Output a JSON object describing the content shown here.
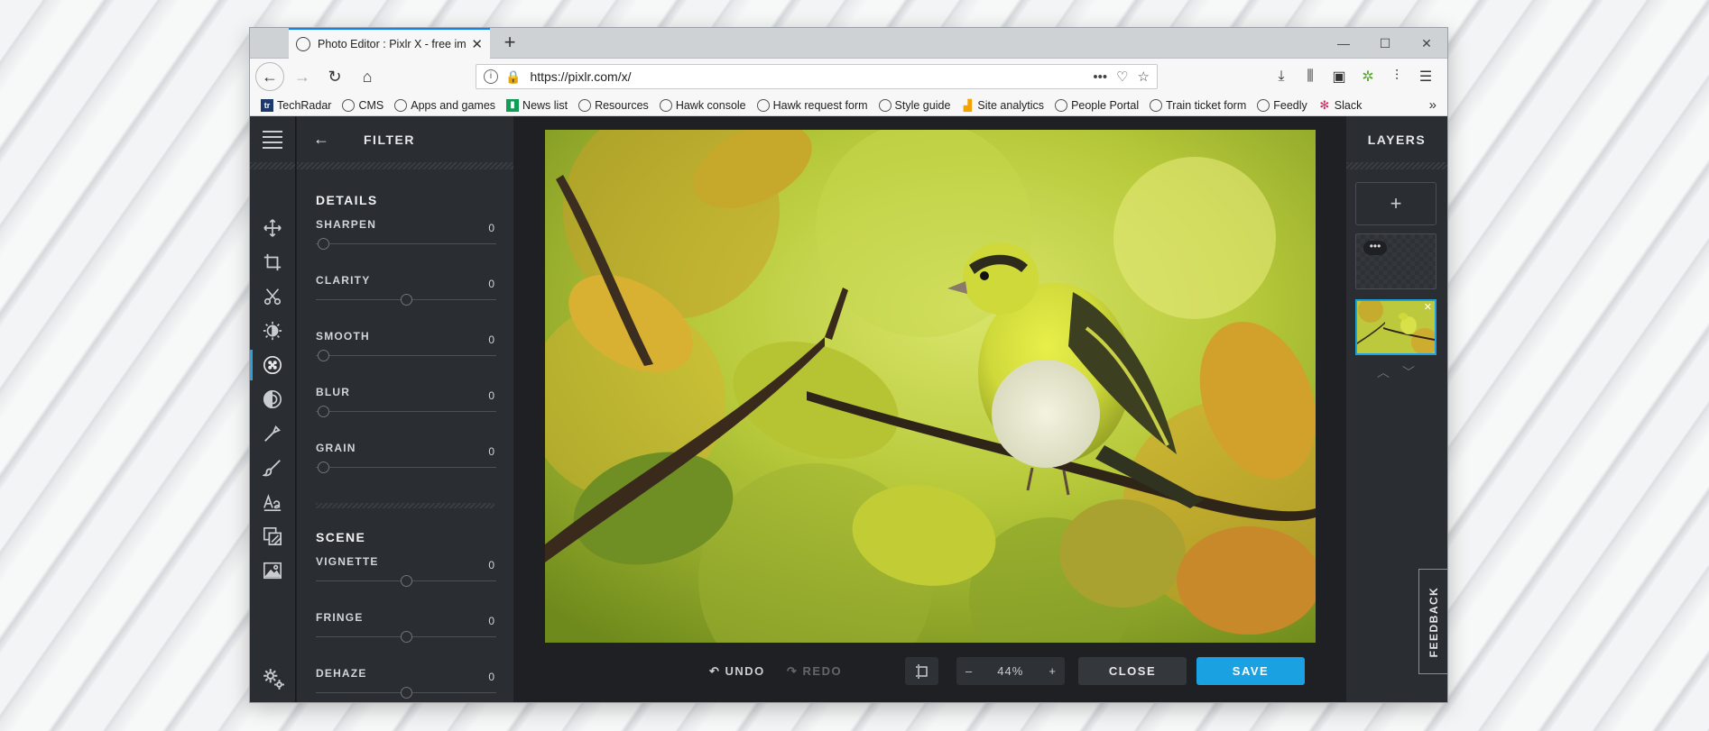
{
  "browser": {
    "tab_title": "Photo Editor : Pixlr X - free image editing online",
    "url": "https://pixlr.com/x/",
    "bookmarks": [
      {
        "label": "TechRadar",
        "icon": "techradar-icon"
      },
      {
        "label": "CMS",
        "icon": "globe-icon"
      },
      {
        "label": "Apps and games",
        "icon": "globe-icon"
      },
      {
        "label": "News list",
        "icon": "news-icon"
      },
      {
        "label": "Resources",
        "icon": "globe-icon"
      },
      {
        "label": "Hawk console",
        "icon": "globe-icon"
      },
      {
        "label": "Hawk request form",
        "icon": "globe-icon"
      },
      {
        "label": "Style guide",
        "icon": "globe-icon"
      },
      {
        "label": "Site analytics",
        "icon": "analytics-icon"
      },
      {
        "label": "People Portal",
        "icon": "globe-icon"
      },
      {
        "label": "Train ticket form",
        "icon": "globe-icon"
      },
      {
        "label": "Feedly",
        "icon": "globe-icon"
      },
      {
        "label": "Slack",
        "icon": "slack-icon"
      }
    ]
  },
  "panel": {
    "title": "FILTER",
    "sections": [
      {
        "title": "DETAILS",
        "sliders": [
          {
            "label": "SHARPEN",
            "value": "0",
            "position": 0.04
          },
          {
            "label": "CLARITY",
            "value": "0",
            "position": 0.5
          },
          {
            "label": "SMOOTH",
            "value": "0",
            "position": 0.04
          },
          {
            "label": "BLUR",
            "value": "0",
            "position": 0.04
          },
          {
            "label": "GRAIN",
            "value": "0",
            "position": 0.04
          }
        ]
      },
      {
        "title": "SCENE",
        "sliders": [
          {
            "label": "VIGNETTE",
            "value": "0",
            "position": 0.5
          },
          {
            "label": "FRINGE",
            "value": "0",
            "position": 0.5
          },
          {
            "label": "DEHAZE",
            "value": "0",
            "position": 0.5
          }
        ]
      }
    ]
  },
  "bottombar": {
    "undo": "UNDO",
    "redo": "REDO",
    "zoom_out": "–",
    "zoom": "44%",
    "zoom_in": "+",
    "close": "CLOSE",
    "save": "SAVE"
  },
  "layers": {
    "title": "LAYERS",
    "add": "+",
    "menu_dots": "•••"
  },
  "feedback": "FEEDBACK",
  "colors": {
    "accent": "#1aa1e1",
    "panel_bg": "#2a2d31",
    "workspace_bg": "#1e2024"
  }
}
